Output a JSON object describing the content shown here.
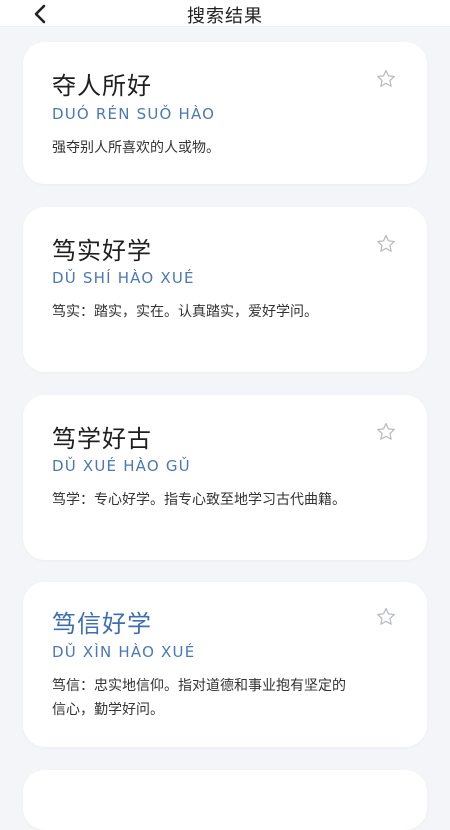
{
  "header": {
    "title": "搜索结果",
    "back_icon": "chevron-left-icon"
  },
  "results": [
    {
      "word": "夺人所好",
      "pinyin": "DUÓ RÉN SUǑ HÀO",
      "desc": "强夺别人所喜欢的人或物。",
      "star_icon": "star-outline-icon"
    },
    {
      "word": "笃实好学",
      "pinyin": "DǓ SHÍ HÀO XUÉ",
      "desc": "笃实：踏实，实在。认真踏实，爱好学问。",
      "star_icon": "star-outline-icon"
    },
    {
      "word": "笃学好古",
      "pinyin": "DǓ XUÉ HÀO GǓ",
      "desc": "笃学：专心好学。指专心致至地学习古代曲籍。",
      "star_icon": "star-outline-icon"
    },
    {
      "word": "笃信好学",
      "pinyin": "DǓ XÌN HÀO XUÉ",
      "desc": "笃信：忠实地信仰。指对道德和事业抱有坚定的信心，勤学好问。",
      "star_icon": "star-outline-icon",
      "highlighted": true
    }
  ],
  "colors": {
    "accent": "#4a78b8",
    "background": "#f3f5f9",
    "card": "#ffffff"
  }
}
